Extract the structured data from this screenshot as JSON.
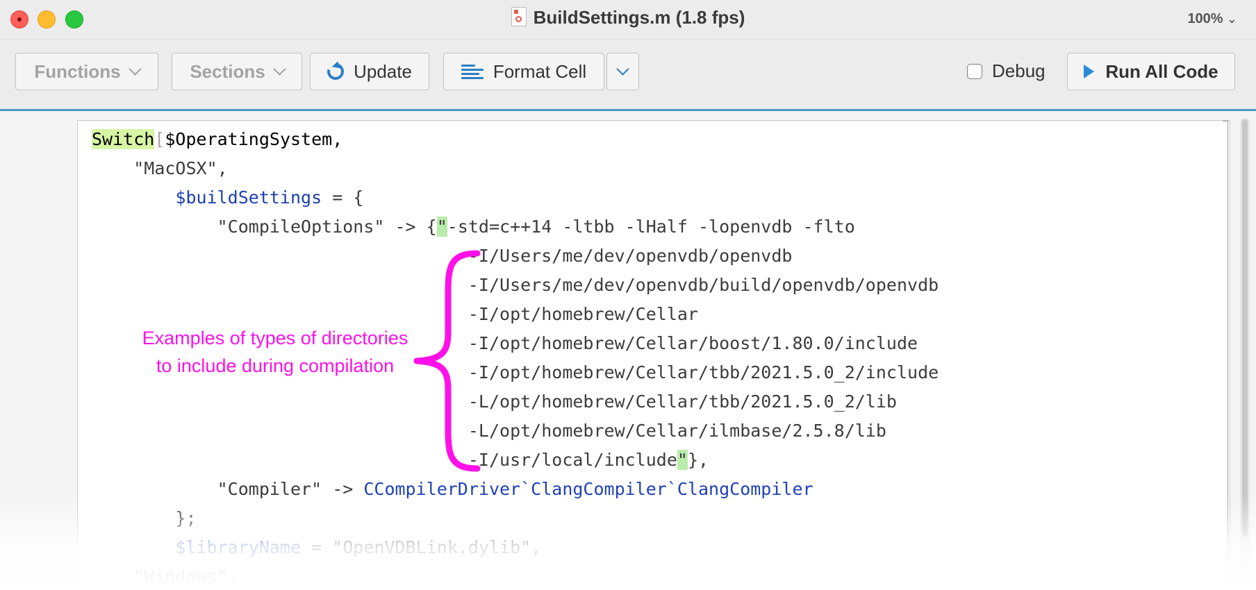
{
  "window": {
    "title": "BuildSettings.m (1.8 fps)",
    "zoom": "100%"
  },
  "toolbar": {
    "functions_label": "Functions",
    "sections_label": "Sections",
    "update_label": "Update",
    "format_cell_label": "Format Cell",
    "debug_label": "Debug",
    "run_all_label": "Run All Code"
  },
  "code": {
    "l1_kw": "Switch",
    "l1_bracket": "[",
    "l1_rest": "$OperatingSystem,",
    "l2": "\"MacOSX\",",
    "l3_var": "$buildSettings",
    "l3_rest": " = {",
    "l4_key": "\"CompileOptions\" -> {",
    "l4_q": "\"",
    "l4_rest": "-std=c++14 -ltbb -lHalf -lopenvdb -flto",
    "includes": [
      "-I/Users/me/dev/openvdb/openvdb",
      "-I/Users/me/dev/openvdb/build/openvdb/openvdb",
      "-I/opt/homebrew/Cellar",
      "-I/opt/homebrew/Cellar/boost/1.80.0/include",
      "-I/opt/homebrew/Cellar/tbb/2021.5.0_2/include",
      "-L/opt/homebrew/Cellar/tbb/2021.5.0_2/lib",
      "-L/opt/homebrew/Cellar/ilmbase/2.5.8/lib"
    ],
    "last_include": "-I/usr/local/include",
    "last_q": "\"",
    "last_tail": "},",
    "l_compiler_key": "\"Compiler\" -> ",
    "l_compiler_val": "CCompilerDriver`ClangCompiler`ClangCompiler",
    "l_close": "};",
    "l_libname_var": "$libraryName",
    "l_libname_rest": " = \"OpenVDBLink.dylib\",",
    "l_windows": "\"Windows\","
  },
  "annotation": {
    "line1": "Examples of types of directories",
    "line2": "to include during compilation",
    "color": "#ff10e8"
  },
  "colors": {
    "accent": "#2b7fc4",
    "symbol_blue": "#1b3fb0",
    "highlight_green": "#d6f5a5"
  }
}
